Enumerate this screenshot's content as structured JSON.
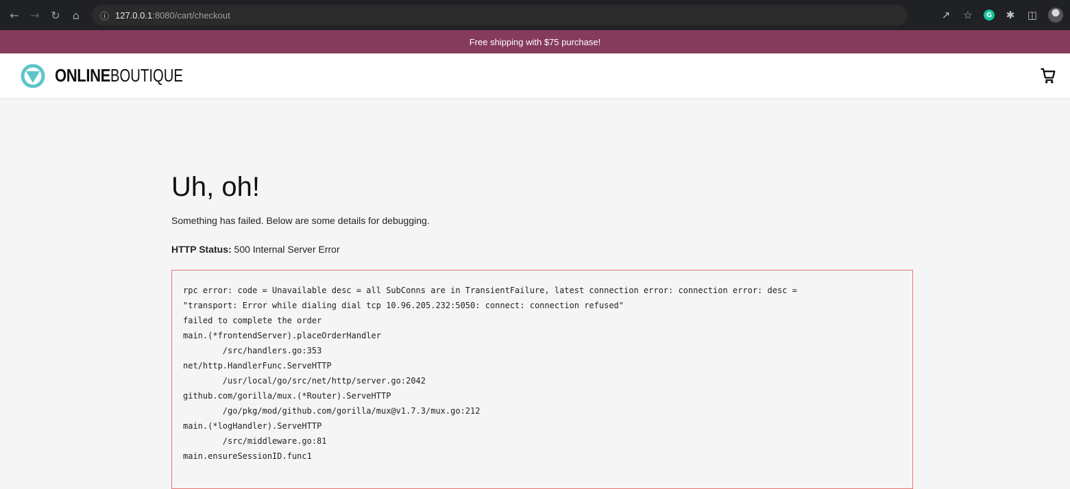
{
  "browser": {
    "nav": {
      "back_icon": "arrow-left-icon",
      "forward_icon": "arrow-right-icon",
      "reload_icon": "reload-icon",
      "home_icon": "home-icon"
    },
    "url_host": "127.0.0.1",
    "url_path": ":8080/cart/checkout",
    "toolbar_icons": [
      "share-icon",
      "bookmark-star-icon",
      "grammarly-icon",
      "extensions-puzzle-icon",
      "side-panel-icon",
      "profile-avatar"
    ],
    "grammarly_letter": "G"
  },
  "promo": {
    "text": "Free shipping with $75 purchase!",
    "color": "#853b5c"
  },
  "header": {
    "brand_bold": "ONLINE",
    "brand_light": "BOUTIQUE",
    "logo_color": "#5ec5c9",
    "cart_icon": "cart-icon"
  },
  "error": {
    "title": "Uh, oh!",
    "message": "Something has failed. Below are some details for debugging.",
    "status_label": "HTTP Status:",
    "status_value": "500 Internal Server Error",
    "border_color": "#e57373",
    "trace": [
      "rpc error: code = Unavailable desc = all SubConns are in TransientFailure, latest connection error: connection error: desc =",
      "\"transport: Error while dialing dial tcp 10.96.205.232:5050: connect: connection refused\"",
      "failed to complete the order",
      "main.(*frontendServer).placeOrderHandler",
      "        /src/handlers.go:353",
      "net/http.HandlerFunc.ServeHTTP",
      "        /usr/local/go/src/net/http/server.go:2042",
      "github.com/gorilla/mux.(*Router).ServeHTTP",
      "        /go/pkg/mod/github.com/gorilla/mux@v1.7.3/mux.go:212",
      "main.(*logHandler).ServeHTTP",
      "        /src/middleware.go:81",
      "main.ensureSessionID.func1"
    ]
  }
}
